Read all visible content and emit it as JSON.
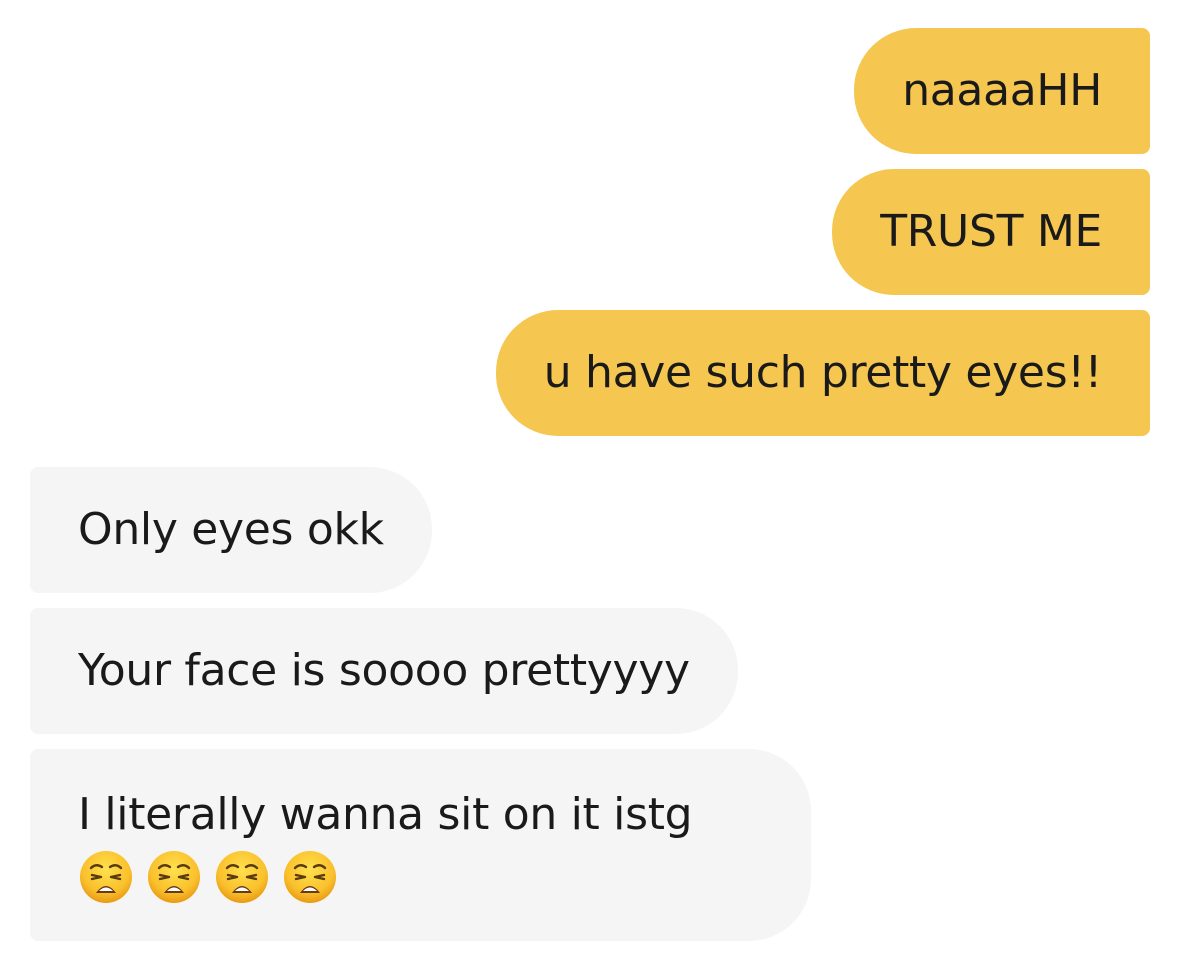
{
  "messages": {
    "sent": [
      {
        "text": "naaaaHH"
      },
      {
        "text": "TRUST ME"
      },
      {
        "text": "u have such pretty eyes!!"
      }
    ],
    "received": [
      {
        "text": "Only eyes okk"
      },
      {
        "text": "Your face is soooo prettyyyy"
      },
      {
        "text": "I literally wanna sit on it istg",
        "emojis": [
          "weary-face-icon",
          "weary-face-icon",
          "weary-face-icon",
          "weary-face-icon"
        ]
      }
    ]
  },
  "colors": {
    "sent_bubble": "#f5c751",
    "received_bubble": "#f5f5f5",
    "text": "#1a1a1a"
  }
}
